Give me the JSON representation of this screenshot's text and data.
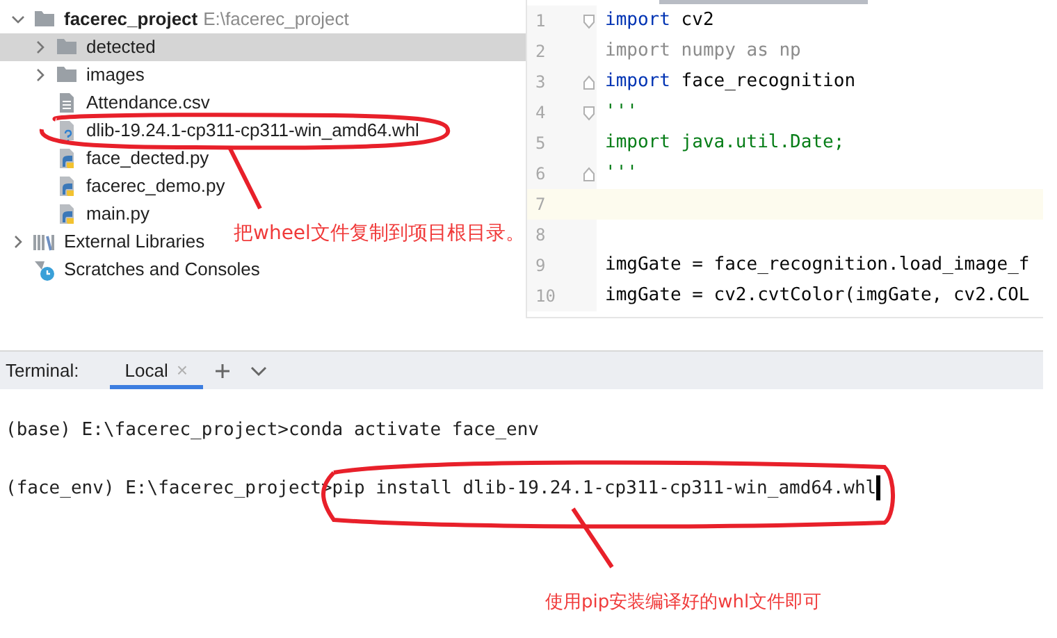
{
  "project_tree": {
    "root": {
      "name": "facerec_project",
      "path": "E:\\facerec_project",
      "expanded": true
    },
    "items": [
      {
        "kind": "folder",
        "name": "detected",
        "expanded": false,
        "selected": true
      },
      {
        "kind": "folder",
        "name": "images",
        "expanded": false,
        "selected": false
      },
      {
        "kind": "csv",
        "name": "Attendance.csv",
        "selected": false
      },
      {
        "kind": "whl",
        "name": "dlib-19.24.1-cp311-cp311-win_amd64.whl",
        "selected": false
      },
      {
        "kind": "python",
        "name": "face_dected.py",
        "selected": false
      },
      {
        "kind": "python",
        "name": "facerec_demo.py",
        "selected": false
      },
      {
        "kind": "python",
        "name": "main.py",
        "selected": false
      }
    ],
    "extra": [
      {
        "kind": "libraries",
        "name": "External Libraries",
        "expanded": false
      },
      {
        "kind": "scratches",
        "name": "Scratches and Consoles"
      }
    ]
  },
  "editor": {
    "lines": [
      {
        "number": "1",
        "kind": "import",
        "keyword": "import",
        "text": "cv2",
        "fold_marker": true,
        "fold_opens": true,
        "current": false
      },
      {
        "number": "2",
        "kind": "unused",
        "text": "import numpy as np",
        "current": false
      },
      {
        "number": "3",
        "kind": "import",
        "keyword": "import",
        "text": "face_recognition",
        "fold_marker": true,
        "fold_opens": false,
        "current": false
      },
      {
        "number": "4",
        "kind": "string",
        "text": "'''",
        "fold_marker": true,
        "fold_opens": true,
        "current": false
      },
      {
        "number": "5",
        "kind": "string",
        "text": "import java.util.Date;",
        "current": false
      },
      {
        "number": "6",
        "kind": "string",
        "text": "'''",
        "fold_marker": true,
        "fold_opens": false,
        "current": false
      },
      {
        "number": "7",
        "current": true
      },
      {
        "number": "8",
        "current": false
      },
      {
        "number": "9",
        "kind": "plain",
        "text": "imgGate = face_recognition.load_image_f",
        "current": false
      },
      {
        "number": "10",
        "kind": "plain",
        "text": "imgGate = cv2.cvtColor(imgGate, cv2.COL",
        "current": false
      }
    ]
  },
  "terminal": {
    "label": "Terminal:",
    "tabs": [
      {
        "label": "Local",
        "selected": true,
        "close": "×"
      }
    ],
    "lines": [
      "(base) E:\\facerec_project>conda activate face_env",
      "(face_env) E:\\facerec_project>pip install dlib-19.24.1-cp311-cp311-win_amd64.whl"
    ]
  },
  "annotations": [
    {
      "text": "把wheel文件复制到项目根目录。"
    },
    {
      "text": "使用pip安装编译好的whl文件即可"
    }
  ]
}
